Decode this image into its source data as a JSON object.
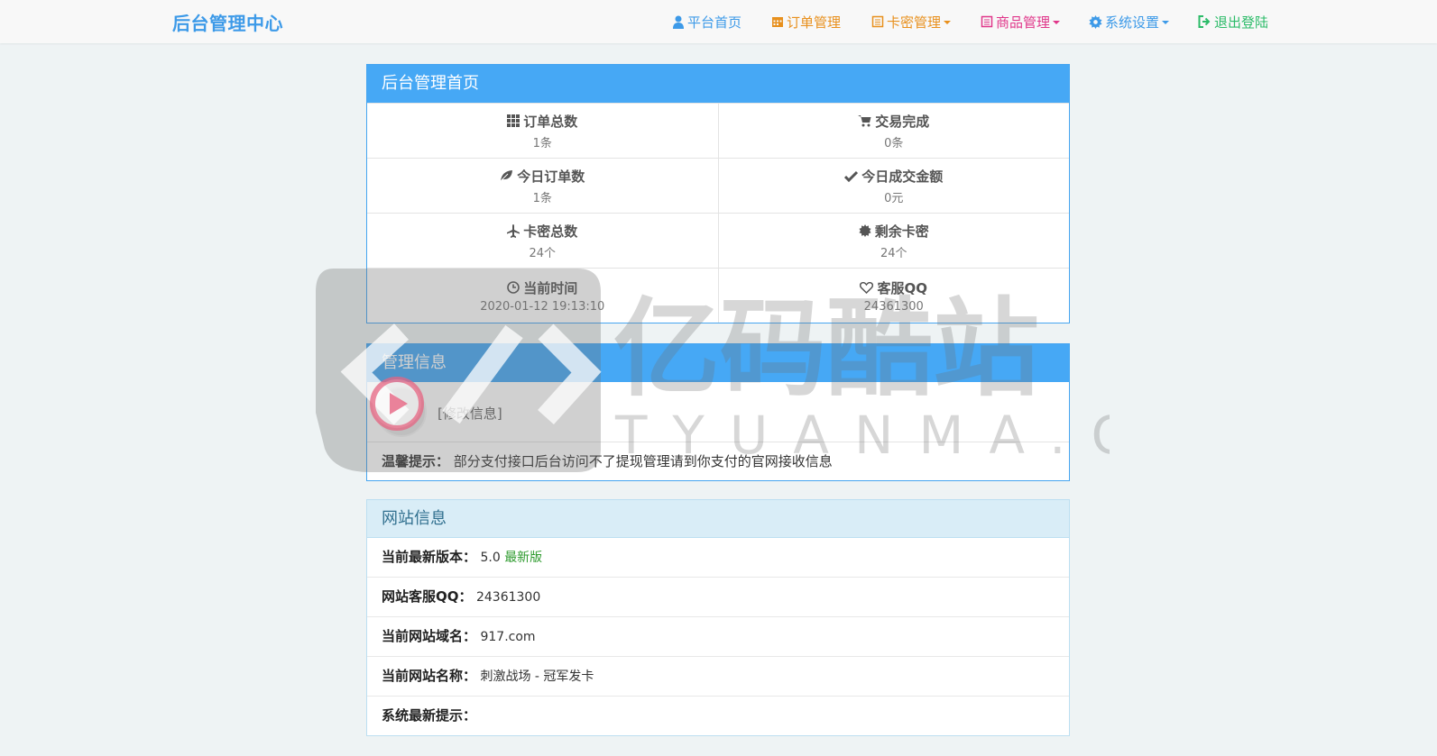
{
  "brand": "后台管理中心",
  "nav": {
    "home": "平台首页",
    "orders": "订单管理",
    "cards": "卡密管理",
    "goods": "商品管理",
    "settings": "系统设置",
    "logout": "退出登陆"
  },
  "nav_colors": {
    "home": "#3d9ae8",
    "orders": "#e8901d",
    "cards": "#e8901d",
    "goods": "#e0368a",
    "settings": "#3d9ae8",
    "logout": "#2bbb68"
  },
  "dashboard": {
    "title": "后台管理首页",
    "stats": [
      {
        "icon": "grid-icon",
        "label": "订单总数",
        "value": "1条"
      },
      {
        "icon": "cart-icon",
        "label": "交易完成",
        "value": "0条"
      },
      {
        "icon": "leaf-icon",
        "label": "今日订单数",
        "value": "1条"
      },
      {
        "icon": "check-icon",
        "label": "今日成交金额",
        "value": "0元"
      },
      {
        "icon": "plane-icon",
        "label": "卡密总数",
        "value": "24个"
      },
      {
        "icon": "cog-burst-icon",
        "label": "剩余卡密",
        "value": "24个"
      },
      {
        "icon": "clock-icon",
        "label": "当前时间",
        "value": "2020-01-12 19:13:10"
      },
      {
        "icon": "heart-icon",
        "label": "客服QQ",
        "value": "24361300"
      }
    ]
  },
  "admin": {
    "title": "管理信息",
    "modify": "[修改信息]",
    "tip_label": "温馨提示：",
    "tip_text": "部分支付接口后台访问不了提现管理请到你支付的官网接收信息"
  },
  "site": {
    "title": "网站信息",
    "rows": [
      {
        "label": "当前最新版本：",
        "value": "5.0",
        "extra": "最新版"
      },
      {
        "label": "网站客服QQ：",
        "value": "24361300"
      },
      {
        "label": "当前网站域名：",
        "value": "917.com"
      },
      {
        "label": "当前网站名称：",
        "value": "刺激战场 - 冠军发卡"
      },
      {
        "label": "系统最新提示：",
        "value": ""
      }
    ]
  },
  "watermark": {
    "cn": "亿码酷站",
    "en": "TYUANMA.CN"
  }
}
